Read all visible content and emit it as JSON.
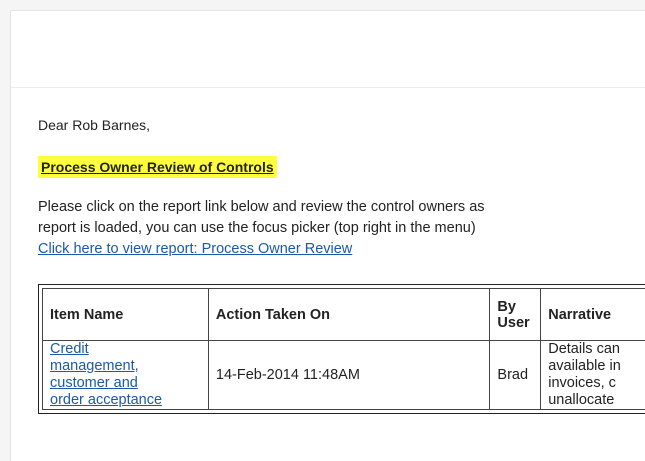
{
  "email": {
    "greeting": "Dear Rob Barnes,",
    "title": "Process Owner Review of Controls",
    "body_line1": "Please click on the report link below and review the control owners as",
    "body_line2": "report is loaded, you can use the focus picker (top right in the menu)",
    "report_link": "Click here to view report: Process Owner Review"
  },
  "table": {
    "headers": {
      "item": "Item Name",
      "action": "Action Taken On",
      "user_line1": "By",
      "user_line2": "User",
      "narrative": "Narrative"
    },
    "rows": [
      {
        "item_lines": [
          "Credit",
          "management,",
          "customer and",
          "order acceptance"
        ],
        "action_taken_on": "14-Feb-2014 11:48AM",
        "by_user": "Brad",
        "narrative_lines": [
          "Details can",
          "available in",
          "invoices, c",
          "unallocate"
        ]
      }
    ]
  },
  "colors": {
    "highlight": "#ffff3b",
    "link": "#1a5aa8"
  }
}
